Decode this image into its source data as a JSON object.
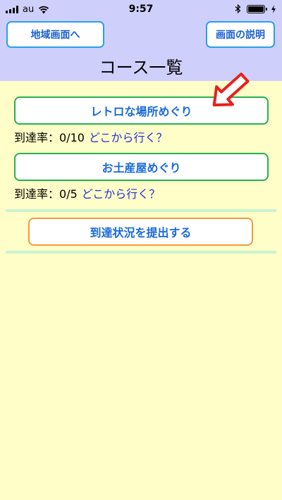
{
  "status_bar": {
    "carrier": "au",
    "time": "9:57"
  },
  "header": {
    "region_button": "地域画面へ",
    "help_button": "画面の説明",
    "title": "コース一覧"
  },
  "courses": [
    {
      "name": "レトロな場所めぐり",
      "progress_label": "到達率：",
      "progress": "0/10",
      "where_link": "どこから行く？"
    },
    {
      "name": "お土産屋めぐり",
      "progress_label": "到達率：",
      "progress": "0/5",
      "where_link": "どこから行く？"
    }
  ],
  "submit_button": "到達状況を提出する",
  "colors": {
    "header_bg": "#cfcffc",
    "body_bg": "#fffdc8",
    "course_border": "#26b050",
    "submit_border": "#f39a3c",
    "arrow": "#e8201c"
  }
}
